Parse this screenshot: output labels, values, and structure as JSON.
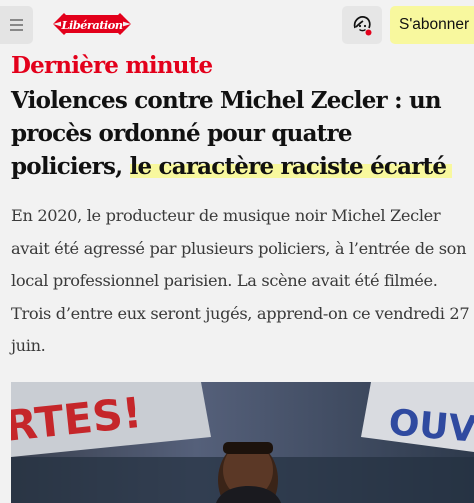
{
  "header": {
    "logo_text": "Libération",
    "subscribe_label": "S'abonner",
    "colors": {
      "brand_red": "#e3001b",
      "highlight_yellow": "#f8f89e"
    }
  },
  "article": {
    "kicker": "Dernière minute",
    "title_plain": "Violences contre Michel Zecler : un procès ordonné pour quatre policiers,",
    "title_highlight": "le caractère raciste écarté",
    "standfirst": "En 2020, le producteur de musique noir Michel Zecler avait été agressé par plusieurs policiers, à l’entrée de son local professionnel parisien. La scène avait été filmée. Trois d’entre eux seront jugés, apprend-on ce vendredi 27 juin.",
    "photo": {
      "banner_left": "RTES!",
      "banner_right": "OUVE"
    }
  },
  "icons": {
    "menu": "hamburger-menu-icon",
    "profile": "user-profile-icon"
  }
}
